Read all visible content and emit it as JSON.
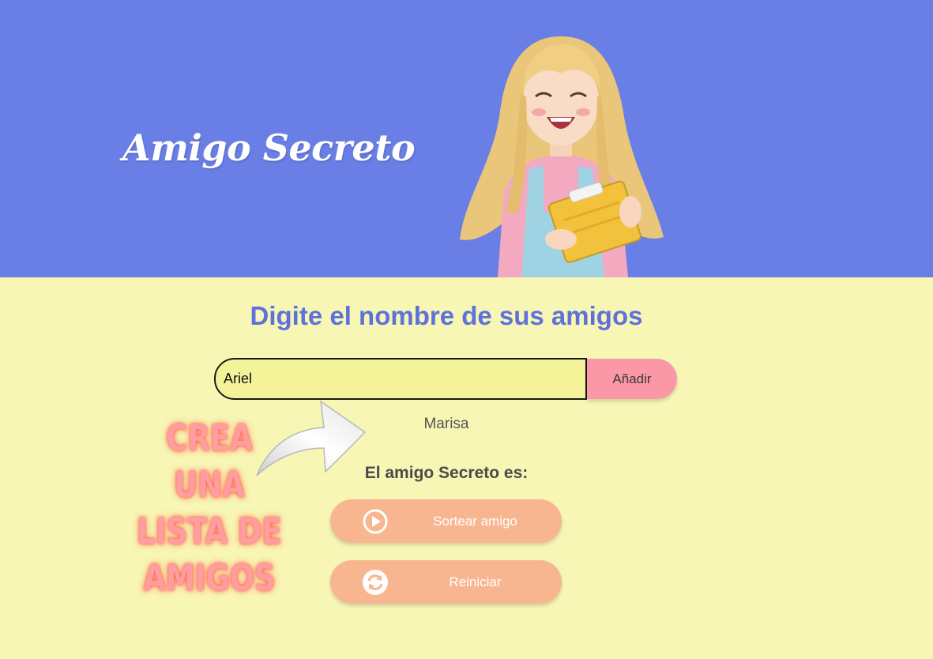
{
  "header": {
    "title": "Amigo Secreto",
    "background": "#6a7fe5"
  },
  "main": {
    "section_title": "Digite el nombre de sus amigos",
    "input": {
      "value": "Ariel",
      "placeholder": ""
    },
    "add_button_label": "Añadir",
    "friends": [
      "Marisa"
    ],
    "result_label": "El amigo Secreto es:",
    "buttons": [
      {
        "label": "Sortear amigo",
        "icon": "play-icon"
      },
      {
        "label": "Reiniciar",
        "icon": "refresh-icon"
      }
    ]
  },
  "overlay": {
    "lines": [
      "CREA",
      "UNA",
      "LISTA DE",
      "AMIGOS"
    ]
  },
  "colors": {
    "page_background": "#f7f6b4",
    "accent": "#5f72dc",
    "add_button": "#fb98a8",
    "action_button": "#f8b690",
    "promo_text": "#ff9da0"
  }
}
